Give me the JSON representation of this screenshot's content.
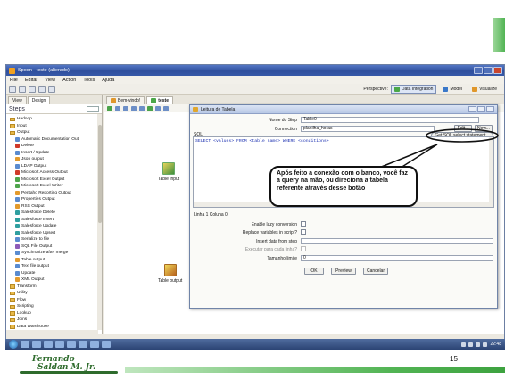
{
  "window": {
    "title": "Spoon - teste (alterado)"
  },
  "menu": [
    "File",
    "Editar",
    "View",
    "Action",
    "Tools",
    "Ajuda"
  ],
  "perspectives": {
    "label": "Perspective:",
    "items": [
      "Data Integration",
      "Model",
      "Visualize"
    ],
    "active": "Data Integration"
  },
  "left_panel": {
    "tabs": [
      "View",
      "Design"
    ],
    "heading": "Steps",
    "tree": [
      {
        "label": "Hadoop",
        "type": "folder",
        "indent": 0
      },
      {
        "label": "Input",
        "type": "folder",
        "indent": 0
      },
      {
        "label": "Output",
        "type": "folder",
        "indent": 0
      },
      {
        "label": "Automatic Documentation Out",
        "type": "step",
        "indent": 1,
        "color": "blue"
      },
      {
        "label": "Delete",
        "type": "step",
        "indent": 1,
        "color": "red"
      },
      {
        "label": "Insert / Update",
        "type": "step",
        "indent": 1,
        "color": "blue"
      },
      {
        "label": "Json output",
        "type": "step",
        "indent": 1,
        "color": "orange"
      },
      {
        "label": "LDAP Output",
        "type": "step",
        "indent": 1,
        "color": "blue"
      },
      {
        "label": "Microsoft Access Output",
        "type": "step",
        "indent": 1,
        "color": "red"
      },
      {
        "label": "Microsoft Excel Output",
        "type": "step",
        "indent": 1,
        "color": "green"
      },
      {
        "label": "Microsoft Excel Writer",
        "type": "step",
        "indent": 1,
        "color": "green"
      },
      {
        "label": "Pentaho Reporting Output",
        "type": "step",
        "indent": 1,
        "color": "orange"
      },
      {
        "label": "Properties Output",
        "type": "step",
        "indent": 1,
        "color": "blue"
      },
      {
        "label": "RSS Output",
        "type": "step",
        "indent": 1,
        "color": "orange"
      },
      {
        "label": "Salesforce Delete",
        "type": "step",
        "indent": 1,
        "color": "teal"
      },
      {
        "label": "Salesforce Insert",
        "type": "step",
        "indent": 1,
        "color": "teal"
      },
      {
        "label": "Salesforce Update",
        "type": "step",
        "indent": 1,
        "color": "teal"
      },
      {
        "label": "Salesforce Upsert",
        "type": "step",
        "indent": 1,
        "color": "teal"
      },
      {
        "label": "Serialize to file",
        "type": "step",
        "indent": 1,
        "color": "blue"
      },
      {
        "label": "SQL File Output",
        "type": "step",
        "indent": 1,
        "color": "purple"
      },
      {
        "label": "Synchronize after merge",
        "type": "step",
        "indent": 1,
        "color": "blue"
      },
      {
        "label": "Table output",
        "type": "step",
        "indent": 1,
        "color": "orange"
      },
      {
        "label": "Text file output",
        "type": "step",
        "indent": 1,
        "color": "blue"
      },
      {
        "label": "Update",
        "type": "step",
        "indent": 1,
        "color": "blue"
      },
      {
        "label": "XML Output",
        "type": "step",
        "indent": 1,
        "color": "orange"
      },
      {
        "label": "Transform",
        "type": "folder",
        "indent": 0
      },
      {
        "label": "Utility",
        "type": "folder",
        "indent": 0
      },
      {
        "label": "Flow",
        "type": "folder",
        "indent": 0
      },
      {
        "label": "Scripting",
        "type": "folder",
        "indent": 0
      },
      {
        "label": "Lookup",
        "type": "folder",
        "indent": 0
      },
      {
        "label": "Joins",
        "type": "folder",
        "indent": 0
      },
      {
        "label": "Data Warehouse",
        "type": "folder",
        "indent": 0
      }
    ]
  },
  "editor": {
    "tabs": [
      "Bem-vindo!",
      "teste"
    ],
    "active_tab": "teste",
    "steps": [
      {
        "label": "Table input",
        "kind": "input"
      },
      {
        "label": "Table output",
        "kind": "output"
      }
    ]
  },
  "dialog": {
    "title": "Leitura de Tabela",
    "step_name_label": "Nome do Step",
    "step_name_value": "Table0",
    "connection_label": "Connection",
    "connection_value": "planilha_horas",
    "edit_button": "Edit...",
    "new_button": "New...",
    "sql_label": "SQL",
    "get_sql_button": "Get SQL select statement...",
    "sql_text": "SELECT <values> FROM <table name> WHERE <conditions>",
    "line_info": "Linha 1 Coluna 0",
    "enable_lazy_label": "Enable lazy conversion",
    "replace_vars_label": "Replace variables in script?",
    "insert_data_label": "Insert data from step",
    "execute_each_label": "Executar para cada linha?",
    "limit_label": "Tamanho limite",
    "limit_value": "0",
    "ok_button": "OK",
    "preview_button": "Preview",
    "cancel_button": "Cancelar"
  },
  "callout": {
    "text": "Após feito a conexão com o banco, você faz a query na mão, ou direciona a tabela referente através desse botão"
  },
  "taskbar": {
    "clock": "22:48"
  },
  "slide": {
    "page_number": "15",
    "logo_line1": "Fernando",
    "logo_line2": "Saldan M. Jr."
  },
  "colors": {
    "accent_green": "#52b454",
    "title_blue": "#2f4f9d"
  }
}
